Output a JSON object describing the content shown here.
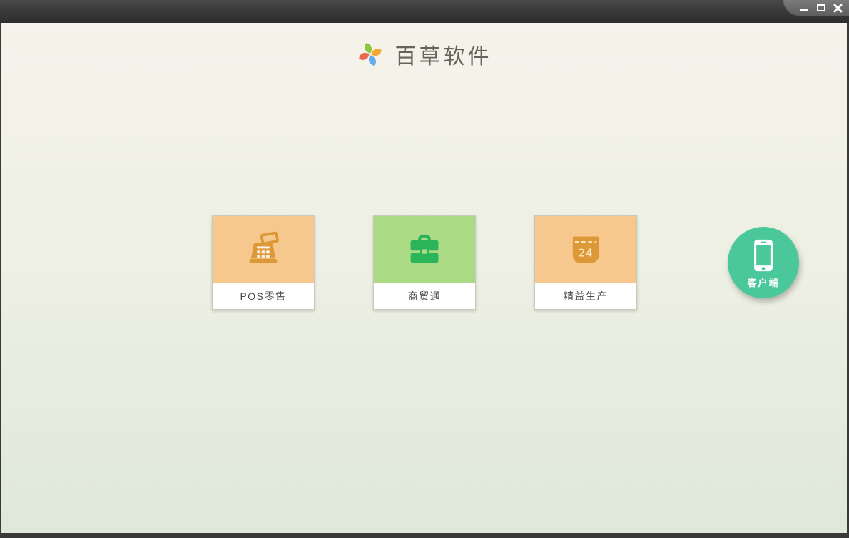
{
  "titlebar": {
    "window_controls": [
      {
        "name": "minimize"
      },
      {
        "name": "maximize"
      },
      {
        "name": "close"
      }
    ]
  },
  "brand": {
    "app_name": "百草软件",
    "logo": "pinwheel-icon"
  },
  "products": [
    {
      "label": "POS零售",
      "icon": "cash-register-icon",
      "tile_color": "#f7c88e",
      "icon_color": "#dd9838"
    },
    {
      "label": "商贸通",
      "icon": "briefcase-icon",
      "tile_color": "#aadb84",
      "icon_color": "#2cb45b"
    },
    {
      "label": "精益生产",
      "icon": "calendar-icon",
      "tile_color": "#f7c88e",
      "icon_color": "#dd9838",
      "calendar_day": "24"
    }
  ],
  "client": {
    "label": "客户端",
    "icon": "smartphone-icon",
    "color": "#4bc79c"
  },
  "colors": {
    "titlebar_dark": "#383838",
    "bg_gradient_top": "#f5f3eb",
    "bg_gradient_bottom": "#dfe8da",
    "card_label_text": "#4a4a4a",
    "logo_green": "#8cc63f",
    "logo_orange": "#f6a731",
    "logo_blue": "#68abe9",
    "logo_red": "#e9684f",
    "icon_detail_light": "#fbe9c9"
  }
}
